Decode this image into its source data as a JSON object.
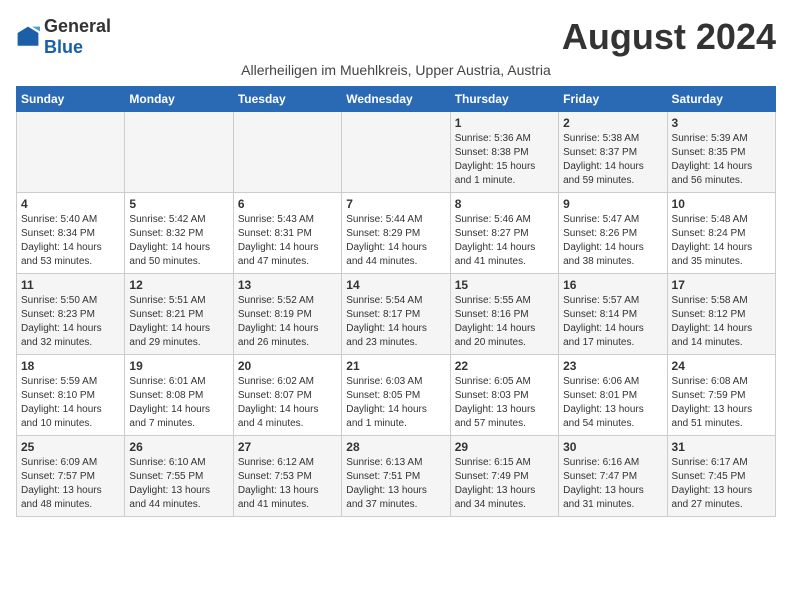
{
  "logo": {
    "general": "General",
    "blue": "Blue"
  },
  "title": "August 2024",
  "subtitle": "Allerheiligen im Muehlkreis, Upper Austria, Austria",
  "days_of_week": [
    "Sunday",
    "Monday",
    "Tuesday",
    "Wednesday",
    "Thursday",
    "Friday",
    "Saturday"
  ],
  "weeks": [
    [
      {
        "day": "",
        "info": ""
      },
      {
        "day": "",
        "info": ""
      },
      {
        "day": "",
        "info": ""
      },
      {
        "day": "",
        "info": ""
      },
      {
        "day": "1",
        "info": "Sunrise: 5:36 AM\nSunset: 8:38 PM\nDaylight: 15 hours\nand 1 minute."
      },
      {
        "day": "2",
        "info": "Sunrise: 5:38 AM\nSunset: 8:37 PM\nDaylight: 14 hours\nand 59 minutes."
      },
      {
        "day": "3",
        "info": "Sunrise: 5:39 AM\nSunset: 8:35 PM\nDaylight: 14 hours\nand 56 minutes."
      }
    ],
    [
      {
        "day": "4",
        "info": "Sunrise: 5:40 AM\nSunset: 8:34 PM\nDaylight: 14 hours\nand 53 minutes."
      },
      {
        "day": "5",
        "info": "Sunrise: 5:42 AM\nSunset: 8:32 PM\nDaylight: 14 hours\nand 50 minutes."
      },
      {
        "day": "6",
        "info": "Sunrise: 5:43 AM\nSunset: 8:31 PM\nDaylight: 14 hours\nand 47 minutes."
      },
      {
        "day": "7",
        "info": "Sunrise: 5:44 AM\nSunset: 8:29 PM\nDaylight: 14 hours\nand 44 minutes."
      },
      {
        "day": "8",
        "info": "Sunrise: 5:46 AM\nSunset: 8:27 PM\nDaylight: 14 hours\nand 41 minutes."
      },
      {
        "day": "9",
        "info": "Sunrise: 5:47 AM\nSunset: 8:26 PM\nDaylight: 14 hours\nand 38 minutes."
      },
      {
        "day": "10",
        "info": "Sunrise: 5:48 AM\nSunset: 8:24 PM\nDaylight: 14 hours\nand 35 minutes."
      }
    ],
    [
      {
        "day": "11",
        "info": "Sunrise: 5:50 AM\nSunset: 8:23 PM\nDaylight: 14 hours\nand 32 minutes."
      },
      {
        "day": "12",
        "info": "Sunrise: 5:51 AM\nSunset: 8:21 PM\nDaylight: 14 hours\nand 29 minutes."
      },
      {
        "day": "13",
        "info": "Sunrise: 5:52 AM\nSunset: 8:19 PM\nDaylight: 14 hours\nand 26 minutes."
      },
      {
        "day": "14",
        "info": "Sunrise: 5:54 AM\nSunset: 8:17 PM\nDaylight: 14 hours\nand 23 minutes."
      },
      {
        "day": "15",
        "info": "Sunrise: 5:55 AM\nSunset: 8:16 PM\nDaylight: 14 hours\nand 20 minutes."
      },
      {
        "day": "16",
        "info": "Sunrise: 5:57 AM\nSunset: 8:14 PM\nDaylight: 14 hours\nand 17 minutes."
      },
      {
        "day": "17",
        "info": "Sunrise: 5:58 AM\nSunset: 8:12 PM\nDaylight: 14 hours\nand 14 minutes."
      }
    ],
    [
      {
        "day": "18",
        "info": "Sunrise: 5:59 AM\nSunset: 8:10 PM\nDaylight: 14 hours\nand 10 minutes."
      },
      {
        "day": "19",
        "info": "Sunrise: 6:01 AM\nSunset: 8:08 PM\nDaylight: 14 hours\nand 7 minutes."
      },
      {
        "day": "20",
        "info": "Sunrise: 6:02 AM\nSunset: 8:07 PM\nDaylight: 14 hours\nand 4 minutes."
      },
      {
        "day": "21",
        "info": "Sunrise: 6:03 AM\nSunset: 8:05 PM\nDaylight: 14 hours\nand 1 minute."
      },
      {
        "day": "22",
        "info": "Sunrise: 6:05 AM\nSunset: 8:03 PM\nDaylight: 13 hours\nand 57 minutes."
      },
      {
        "day": "23",
        "info": "Sunrise: 6:06 AM\nSunset: 8:01 PM\nDaylight: 13 hours\nand 54 minutes."
      },
      {
        "day": "24",
        "info": "Sunrise: 6:08 AM\nSunset: 7:59 PM\nDaylight: 13 hours\nand 51 minutes."
      }
    ],
    [
      {
        "day": "25",
        "info": "Sunrise: 6:09 AM\nSunset: 7:57 PM\nDaylight: 13 hours\nand 48 minutes."
      },
      {
        "day": "26",
        "info": "Sunrise: 6:10 AM\nSunset: 7:55 PM\nDaylight: 13 hours\nand 44 minutes."
      },
      {
        "day": "27",
        "info": "Sunrise: 6:12 AM\nSunset: 7:53 PM\nDaylight: 13 hours\nand 41 minutes."
      },
      {
        "day": "28",
        "info": "Sunrise: 6:13 AM\nSunset: 7:51 PM\nDaylight: 13 hours\nand 37 minutes."
      },
      {
        "day": "29",
        "info": "Sunrise: 6:15 AM\nSunset: 7:49 PM\nDaylight: 13 hours\nand 34 minutes."
      },
      {
        "day": "30",
        "info": "Sunrise: 6:16 AM\nSunset: 7:47 PM\nDaylight: 13 hours\nand 31 minutes."
      },
      {
        "day": "31",
        "info": "Sunrise: 6:17 AM\nSunset: 7:45 PM\nDaylight: 13 hours\nand 27 minutes."
      }
    ]
  ]
}
